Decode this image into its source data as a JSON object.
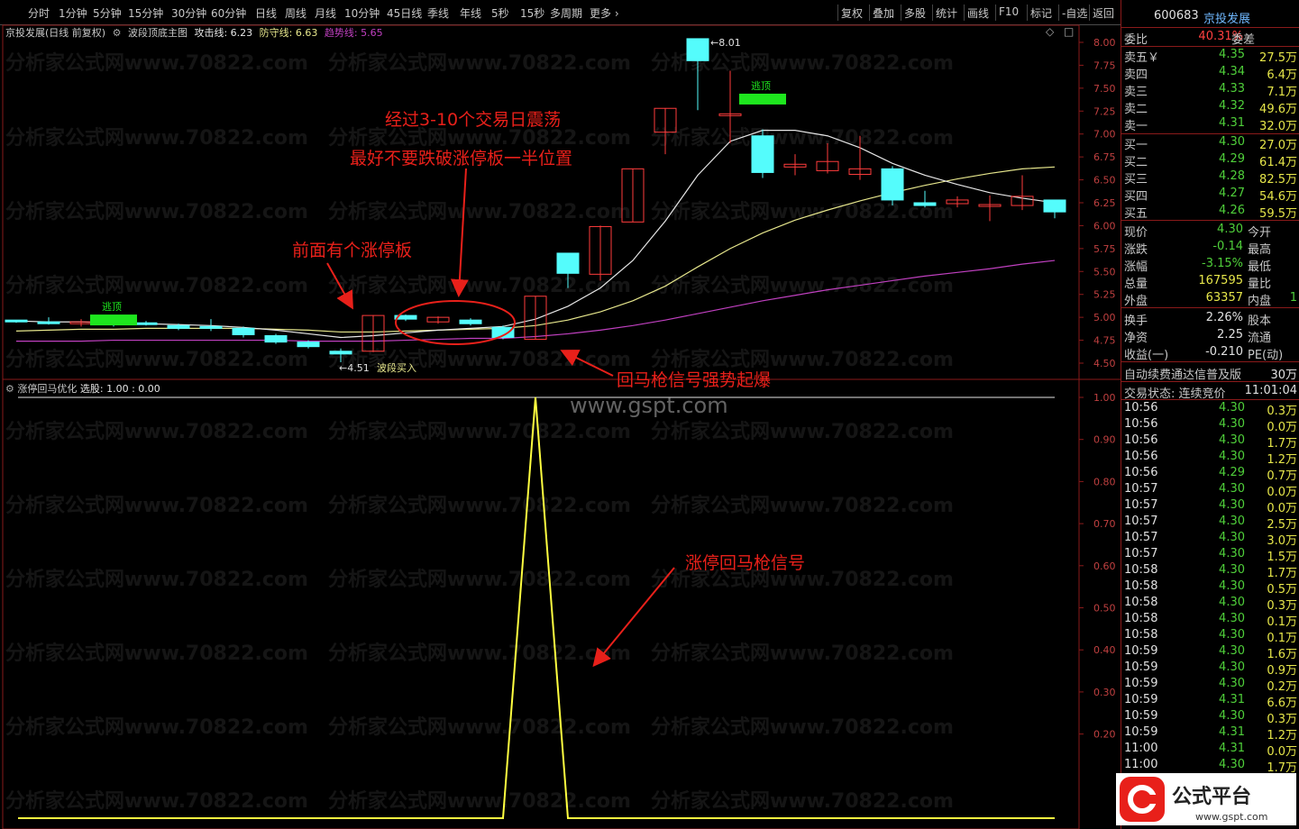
{
  "toolbar": {
    "periods": [
      "分时",
      "1分钟",
      "5分钟",
      "15分钟",
      "30分钟",
      "60分钟",
      "日线",
      "周线",
      "月线",
      "10分钟",
      "45日线",
      "季线",
      "年线",
      "5秒",
      "15秒",
      "多周期",
      "更多"
    ],
    "right_items": [
      "复权",
      "叠加",
      "多股",
      "统计",
      "画线",
      "F10",
      "标记",
      "自选",
      "返回"
    ]
  },
  "main_chart": {
    "title": "京投发展(日线 前复权)",
    "indicator_name": "波段顶底主图",
    "attack_label": "攻击线: 6.23",
    "defense_label": "防守线: 6.63",
    "trend_label": "趋势线: 5.65",
    "yticks": [
      "8.00",
      "7.75",
      "7.50",
      "7.25",
      "7.00",
      "6.75",
      "6.50",
      "6.25",
      "6.00",
      "5.75",
      "5.50",
      "5.25",
      "5.00",
      "4.75",
      "4.50"
    ],
    "high_label": "8.01",
    "low_label": "4.51",
    "buy_label": "波段买入",
    "escape_label": "逃顶",
    "colors": {
      "up": "#ff3c3c",
      "down": "#54fcfc",
      "ma_white": "#e6e6e6",
      "ma_yellow": "#e6e68c",
      "ma_purple": "#c040c0",
      "escape": "#1ee61e"
    }
  },
  "sub_chart": {
    "title": "涨停回马优化",
    "select_label": "选股: 1.00 : 0.00",
    "yticks": [
      "1.00",
      "0.90",
      "0.80",
      "0.70",
      "0.60",
      "0.50",
      "0.40",
      "0.30",
      "0.20"
    ]
  },
  "annotations": {
    "a1": "经过3-10个交易日震荡",
    "a2": "最好不要跌破涨停板一半位置",
    "a3": "前面有个涨停板",
    "a4": "回马枪信号强势起爆",
    "a5": "涨停回马枪信号"
  },
  "watermark": "分析家公式网www.70822.com",
  "gspt": "www.gspt.com",
  "quote": {
    "code": "600683",
    "name": "京投发展",
    "webi_label": "委比",
    "webi_value": "40.31%",
    "weicha_label": "委差",
    "asks": [
      {
        "label": "卖五",
        "price": "4.35",
        "vol": "27.5万"
      },
      {
        "label": "卖四",
        "price": "4.34",
        "vol": "6.4万"
      },
      {
        "label": "卖三",
        "price": "4.33",
        "vol": "7.1万"
      },
      {
        "label": "卖二",
        "price": "4.32",
        "vol": "49.6万"
      },
      {
        "label": "卖一",
        "price": "4.31",
        "vol": "32.0万"
      }
    ],
    "bids": [
      {
        "label": "买一",
        "price": "4.30",
        "vol": "27.0万"
      },
      {
        "label": "买二",
        "price": "4.29",
        "vol": "61.4万"
      },
      {
        "label": "买三",
        "price": "4.28",
        "vol": "82.5万"
      },
      {
        "label": "买四",
        "price": "4.27",
        "vol": "54.6万"
      },
      {
        "label": "买五",
        "price": "4.26",
        "vol": "59.5万"
      }
    ],
    "stats": [
      {
        "l1": "现价",
        "v1": "4.30",
        "l2": "今开"
      },
      {
        "l1": "涨跌",
        "v1": "-0.14",
        "l2": "最高"
      },
      {
        "l1": "涨幅",
        "v1": "-3.15%",
        "l2": "最低"
      },
      {
        "l1": "总量",
        "v1": "167595",
        "l2": "量比"
      },
      {
        "l1": "外盘",
        "v1": "63357",
        "l2": "内盘"
      }
    ],
    "stats2": [
      {
        "l1": "换手",
        "v1": "2.26%",
        "l2": "股本"
      },
      {
        "l1": "净资",
        "v1": "2.25",
        "l2": "流通"
      },
      {
        "l1": "收益(一)",
        "v1": "-0.210",
        "l2": "PE(动)"
      }
    ],
    "ad_text": "自动续费通达信普及版",
    "ad_right": "30万",
    "trade_status": "交易状态: 连续竞价",
    "trade_time": "11:01:04",
    "ticks": [
      {
        "t": "10:56",
        "p": "4.30",
        "v": "0.3万"
      },
      {
        "t": "10:56",
        "p": "4.30",
        "v": "0.0万"
      },
      {
        "t": "10:56",
        "p": "4.30",
        "v": "1.7万"
      },
      {
        "t": "10:56",
        "p": "4.30",
        "v": "1.2万"
      },
      {
        "t": "10:56",
        "p": "4.29",
        "v": "0.7万"
      },
      {
        "t": "10:57",
        "p": "4.30",
        "v": "0.0万"
      },
      {
        "t": "10:57",
        "p": "4.30",
        "v": "0.0万"
      },
      {
        "t": "10:57",
        "p": "4.30",
        "v": "2.5万"
      },
      {
        "t": "10:57",
        "p": "4.30",
        "v": "3.0万"
      },
      {
        "t": "10:57",
        "p": "4.30",
        "v": "1.5万"
      },
      {
        "t": "10:58",
        "p": "4.30",
        "v": "1.7万"
      },
      {
        "t": "10:58",
        "p": "4.30",
        "v": "0.5万"
      },
      {
        "t": "10:58",
        "p": "4.30",
        "v": "0.3万"
      },
      {
        "t": "10:58",
        "p": "4.30",
        "v": "0.1万"
      },
      {
        "t": "10:58",
        "p": "4.30",
        "v": "0.1万"
      },
      {
        "t": "10:59",
        "p": "4.30",
        "v": "1.6万"
      },
      {
        "t": "10:59",
        "p": "4.30",
        "v": "0.9万"
      },
      {
        "t": "10:59",
        "p": "4.30",
        "v": "0.2万"
      },
      {
        "t": "10:59",
        "p": "4.31",
        "v": "6.6万"
      },
      {
        "t": "10:59",
        "p": "4.30",
        "v": "0.3万"
      },
      {
        "t": "10:59",
        "p": "4.31",
        "v": "1.2万"
      },
      {
        "t": "11:00",
        "p": "4.31",
        "v": "0.0万"
      },
      {
        "t": "11:00",
        "p": "4.30",
        "v": "1.7万"
      }
    ]
  },
  "logo_text": "公式平台",
  "logo_url": "www.gspt.com"
}
